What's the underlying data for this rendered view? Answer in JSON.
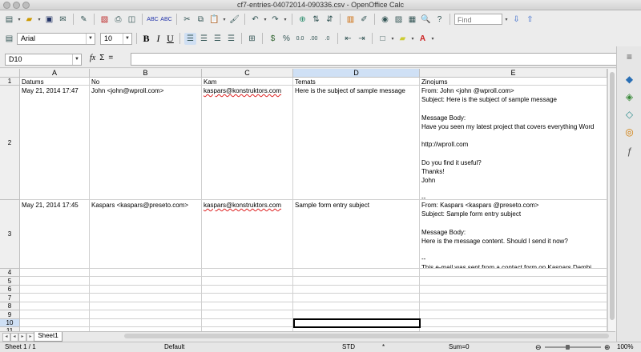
{
  "window": {
    "title": "cf7-entries-04072014-090336.csv - OpenOffice Calc"
  },
  "toolbar": {
    "find_placeholder": "Find",
    "font_name": "Arial",
    "font_size": "10",
    "bold": "B",
    "italic": "I",
    "underline": "U"
  },
  "formula_bar": {
    "name_box": "D10",
    "fx": "fx",
    "sum": "Σ",
    "equals": "=",
    "content": ""
  },
  "columns": [
    "A",
    "B",
    "C",
    "D",
    "E"
  ],
  "rows": [
    "1",
    "2",
    "3",
    "4",
    "5",
    "6",
    "7",
    "8",
    "9",
    "10",
    "11"
  ],
  "cells": {
    "r1": [
      "Datums",
      "No",
      "Kam",
      "Temats",
      "Zinojums"
    ],
    "r2": [
      "May 21, 2014 17:47",
      "John <john@wproll.com>",
      "kaspars@konstruktors.com",
      "Here is the subject of sample message",
      "From: John <john @wproll.com>\nSubject: Here is the subject of sample message\n\nMessage Body:\nHave you seen my latest project that covers everything Word\n\nhttp://wproll.com\n\nDo you find it useful?\nThanks!\nJohn\n\n--\nThis e-mail was sent from a contact form on Kaspars Dambi"
    ],
    "r3": [
      "May 21, 2014 17:45",
      "Kaspars <kaspars@preseto.com>",
      "kaspars@konstruktors.com",
      "Sample form entry subject",
      "From: Kaspars <kaspars @preseto.com>\nSubject: Sample form entry subject\n\nMessage Body:\nHere is the message content. Should I send it now?\n\n--\nThis e-mail was sent from a contact form on Kaspars Dambi"
    ]
  },
  "sheet_tabs": [
    "Sheet1"
  ],
  "status": {
    "sheet": "Sheet 1 / 1",
    "style": "Default",
    "mode": "STD",
    "modified": "*",
    "sum": "Sum=0",
    "zoom": "100%"
  }
}
